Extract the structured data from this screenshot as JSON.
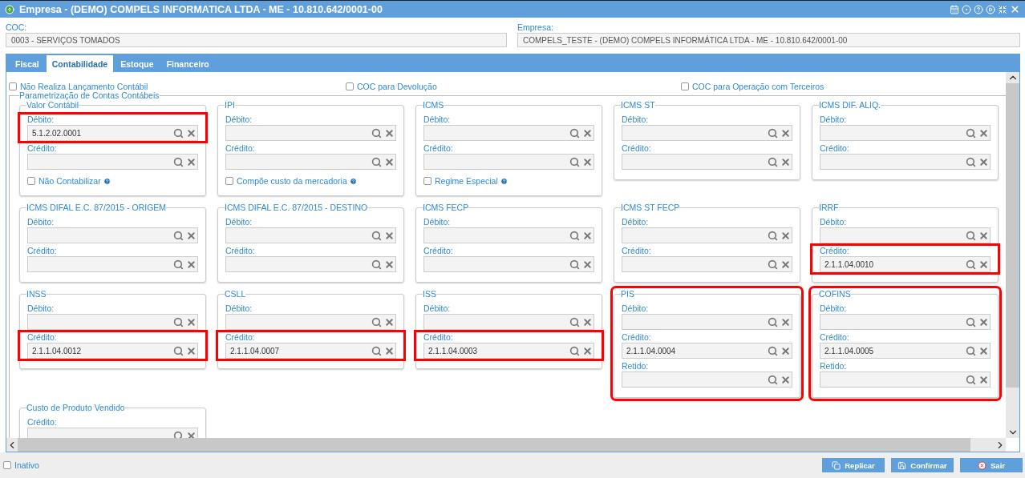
{
  "window": {
    "title": "Empresa - (DEMO) COMPELS INFORMATICA LTDA - ME - 10.810.642/0001-00"
  },
  "header": [
    {
      "label": "COC:",
      "value": "0003 - SERVIÇOS TOMADOS"
    },
    {
      "label": "Empresa:",
      "value": "COMPELS_TESTE - (DEMO) COMPELS INFORMÁTICA LTDA - ME - 10.810.642/0001-00"
    }
  ],
  "tabs": [
    {
      "label": "Fiscal",
      "selected": false
    },
    {
      "label": "Contabilidade",
      "selected": true
    },
    {
      "label": "Estoque",
      "selected": false
    },
    {
      "label": "Financeiro",
      "selected": false
    }
  ],
  "options": [
    {
      "label": "Não Realiza Lançamento Contábil",
      "checked": false
    },
    {
      "label": "COC para Devolução",
      "checked": false
    },
    {
      "label": "COC para Operação com Terceiros",
      "checked": false
    }
  ],
  "section": {
    "title": "Parametrização de Contas Contábeis",
    "groups": [
      {
        "title": "Valor Contábil",
        "highlighted": false,
        "fields": [
          {
            "label": "Débito:",
            "value": "5.1.2.02.0001",
            "highlighted": true
          },
          {
            "label": "Crédito:",
            "highlighted": false
          }
        ],
        "option": {
          "label": "Não Contabilizar",
          "checked": false
        }
      },
      {
        "title": "IPI",
        "highlighted": false,
        "fields": [
          {
            "label": "Débito:",
            "highlighted": false
          },
          {
            "label": "Crédito:",
            "highlighted": false
          }
        ],
        "option": {
          "label": "Compõe custo da mercadoria",
          "checked": false
        }
      },
      {
        "title": "ICMS",
        "highlighted": false,
        "fields": [
          {
            "label": "Débito:",
            "highlighted": false
          },
          {
            "label": "Crédito:",
            "highlighted": false
          }
        ],
        "option": {
          "label": "Regime Especial",
          "checked": false
        }
      },
      {
        "title": "ICMS ST",
        "highlighted": false,
        "fields": [
          {
            "label": "Débito:",
            "highlighted": false
          },
          {
            "label": "Crédito:",
            "highlighted": false
          }
        ]
      },
      {
        "title": "ICMS DIF. ALIQ.",
        "highlighted": false,
        "fields": [
          {
            "label": "Débito:",
            "highlighted": false
          },
          {
            "label": "Crédito:",
            "highlighted": false
          }
        ]
      },
      {
        "title": "ICMS DIFAL E.C. 87/2015 - ORIGEM",
        "highlighted": false,
        "fields": [
          {
            "label": "Débito:",
            "highlighted": false
          },
          {
            "label": "Crédito:",
            "highlighted": false
          }
        ]
      },
      {
        "title": "ICMS DIFAL E.C. 87/2015 - DESTINO",
        "highlighted": false,
        "fields": [
          {
            "label": "Débito:",
            "highlighted": false
          },
          {
            "label": "Crédito:",
            "highlighted": false
          }
        ]
      },
      {
        "title": "ICMS FECP",
        "highlighted": false,
        "fields": [
          {
            "label": "Débito:",
            "highlighted": false
          },
          {
            "label": "Crédito:",
            "highlighted": false
          }
        ]
      },
      {
        "title": "ICMS ST FECP",
        "highlighted": false,
        "fields": [
          {
            "label": "Débito:",
            "highlighted": false
          },
          {
            "label": "Crédito:",
            "highlighted": false
          }
        ]
      },
      {
        "title": "IRRF",
        "highlighted": false,
        "fields": [
          {
            "label": "Débito:",
            "highlighted": false
          },
          {
            "label": "Crédito:",
            "value": "2.1.1.04.0010",
            "highlighted": true
          }
        ]
      },
      {
        "title": "INSS",
        "highlighted": false,
        "fields": [
          {
            "label": "Débito:",
            "highlighted": false
          },
          {
            "label": "Crédito:",
            "value": "2.1.1.04.0012",
            "highlighted": true
          }
        ]
      },
      {
        "title": "CSLL",
        "highlighted": false,
        "fields": [
          {
            "label": "Débito:",
            "highlighted": false
          },
          {
            "label": "Crédito:",
            "value": "2.1.1.04.0007",
            "highlighted": true
          }
        ]
      },
      {
        "title": "ISS",
        "highlighted": false,
        "fields": [
          {
            "label": "Débito:",
            "highlighted": false
          },
          {
            "label": "Crédito:",
            "value": "2.1.1.04.0003",
            "highlighted": true
          }
        ]
      },
      {
        "title": "PIS",
        "highlighted": true,
        "fields": [
          {
            "label": "Débito:",
            "highlighted": false
          },
          {
            "label": "Crédito:",
            "value": "2.1.1.04.0004",
            "highlighted": false
          },
          {
            "label": "Retido:",
            "highlighted": false
          }
        ]
      },
      {
        "title": "COFINS",
        "highlighted": true,
        "fields": [
          {
            "label": "Débito:",
            "highlighted": false
          },
          {
            "label": "Crédito:",
            "value": "2.1.1.04.0005",
            "highlighted": false
          },
          {
            "label": "Retido:",
            "highlighted": false
          }
        ]
      },
      {
        "title": "Custo de Produto Vendido",
        "highlighted": false,
        "fields": [
          {
            "label": "Crédito:",
            "highlighted": false
          }
        ]
      }
    ]
  },
  "footer": {
    "option": {
      "label": "Inativo",
      "checked": false
    },
    "buttons": [
      {
        "label": "Replicar",
        "kind": "replicate"
      },
      {
        "label": "Confirmar",
        "kind": "confirm"
      },
      {
        "label": "Sair",
        "kind": "exit"
      }
    ]
  }
}
